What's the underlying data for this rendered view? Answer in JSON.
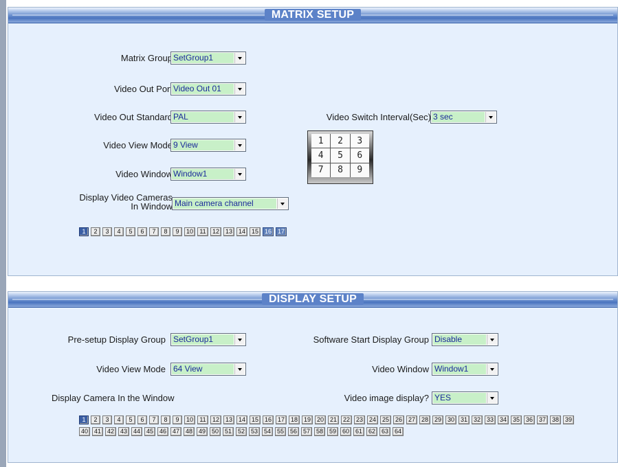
{
  "matrix_setup": {
    "title": "MATRIX SETUP",
    "matrix_group": {
      "label": "Matrix Group",
      "value": "SetGroup1"
    },
    "video_out_port": {
      "label": "Video Out Port",
      "value": "Video Out 01"
    },
    "video_out_standard": {
      "label": "Video Out Standard",
      "value": "PAL"
    },
    "video_switch_interval": {
      "label": "Video Switch Interval(Sec)",
      "value": "3 sec"
    },
    "video_view_mode": {
      "label": "Video View Mode",
      "value": "9 View"
    },
    "video_window": {
      "label": "Video Window",
      "value": "Window1"
    },
    "display_video_cameras": {
      "label_line1": "Display Video Cameras",
      "label_line2": "In Window",
      "value": "Main camera channel"
    },
    "layout_grid": [
      "1",
      "2",
      "3",
      "4",
      "5",
      "6",
      "7",
      "8",
      "9"
    ],
    "channels": [
      "1",
      "2",
      "3",
      "4",
      "5",
      "6",
      "7",
      "8",
      "9",
      "10",
      "11",
      "12",
      "13",
      "14",
      "15",
      "16",
      "17"
    ],
    "selected_channels": [
      "1",
      "16",
      "17"
    ]
  },
  "display_setup": {
    "title": "DISPLAY SETUP",
    "presetup_display_group": {
      "label": "Pre-setup  Display Group",
      "value": "SetGroup1"
    },
    "software_start_display_group": {
      "label": "Software Start Display Group",
      "value": "Disable"
    },
    "video_view_mode": {
      "label": "Video View Mode",
      "value": "64 View"
    },
    "video_window": {
      "label": "Video Window",
      "value": "Window1"
    },
    "display_camera_label": "Display Camera In the Window",
    "video_image_display": {
      "label": "Video image display?",
      "value": "YES"
    },
    "channels": [
      "1",
      "2",
      "3",
      "4",
      "5",
      "6",
      "7",
      "8",
      "9",
      "10",
      "11",
      "12",
      "13",
      "14",
      "15",
      "16",
      "17",
      "18",
      "19",
      "20",
      "21",
      "22",
      "23",
      "24",
      "25",
      "26",
      "27",
      "28",
      "29",
      "30",
      "31",
      "32",
      "33",
      "34",
      "35",
      "36",
      "37",
      "38",
      "39",
      "40",
      "41",
      "42",
      "43",
      "44",
      "45",
      "46",
      "47",
      "48",
      "49",
      "50",
      "51",
      "52",
      "53",
      "54",
      "55",
      "56",
      "57",
      "58",
      "59",
      "60",
      "61",
      "62",
      "63",
      "64"
    ],
    "selected_channels": [
      "1"
    ]
  },
  "colors": {
    "panel_bg": "#e6f0fd",
    "header_blue": "#4a74bf",
    "select_value_bg": "#c8f0c8",
    "select_value_text": "#1a2a9a",
    "selected_channel_bg": "#3b5fa5"
  }
}
